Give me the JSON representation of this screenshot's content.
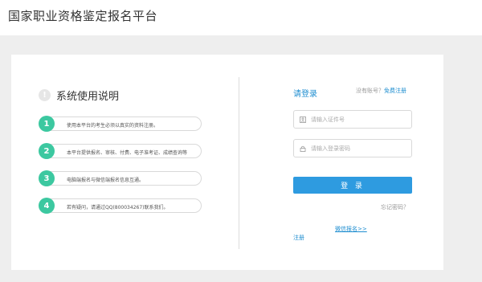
{
  "header": {
    "site_title": "国家职业资格鉴定报名平台"
  },
  "help": {
    "icon": "info-icon",
    "title": "系统使用说明",
    "steps": [
      {
        "num": "1",
        "text": "使用本平台的考生必须以真实的资料注册。"
      },
      {
        "num": "2",
        "text": "本平台提供报名、审核、付费、电子准考证、成绩查询等"
      },
      {
        "num": "3",
        "text": "电脑端报名与微信端报名信息互通。"
      },
      {
        "num": "4",
        "text": "若有疑问，请通过QQ(800034267)联系我们。"
      }
    ]
  },
  "login": {
    "title": "请登录",
    "no_account_text": "没有账号？",
    "free_register_link": "免费注册",
    "id_placeholder": "请输入证件号",
    "password_placeholder": "请输入登录密码",
    "login_button": "登 录",
    "forgot_password": "忘记密码？",
    "wechat_register": "微信报名>>",
    "register_link": "注册"
  },
  "colors": {
    "accent": "#2e9be0",
    "link": "#1f8ed0",
    "step_badge": "#3cc8a0",
    "page_bg": "#eeeeee"
  }
}
